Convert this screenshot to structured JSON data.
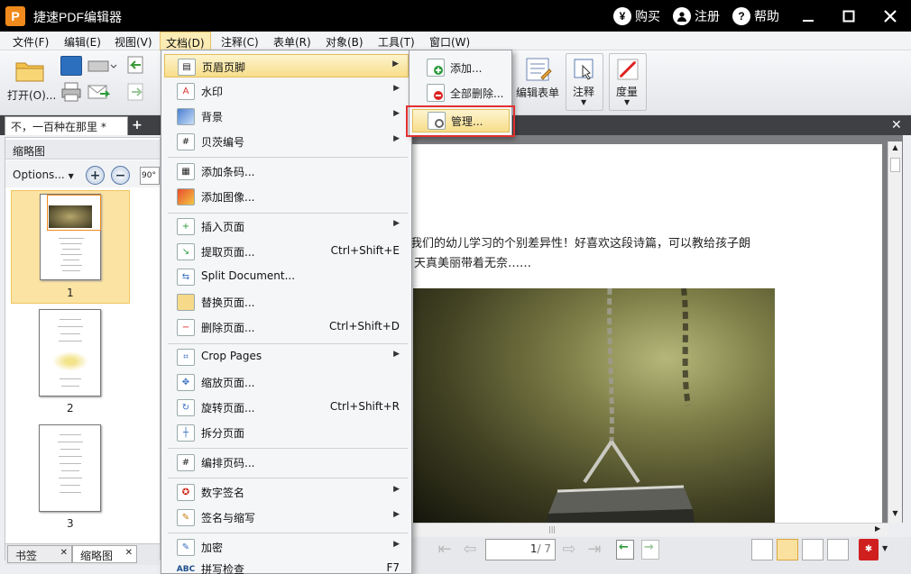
{
  "app": {
    "logo": "P",
    "title": "捷速PDF编辑器"
  },
  "titlebar": {
    "buy": "购买",
    "register": "注册",
    "help": "帮助",
    "buy_icon": "¥",
    "register_icon": "user-icon",
    "help_icon": "?"
  },
  "menubar": [
    "文件(F)",
    "编辑(E)",
    "视图(V)",
    "文档(D)",
    "注释(C)",
    "表单(R)",
    "对象(B)",
    "工具(T)",
    "窗口(W)"
  ],
  "toolbar": {
    "open_label": "打开(O)...",
    "edit_form_label": "编辑表单",
    "annotate_label": "注释",
    "measure_label": "度量"
  },
  "doc_tab": {
    "label": "不，一百种在那里 *"
  },
  "left_panel": {
    "title": "缩略图",
    "options_label": "Options...",
    "rotate_label": "90°",
    "thumbnails": [
      "1",
      "2",
      "3"
    ],
    "bottom_tabs": [
      {
        "label": "书签"
      },
      {
        "label": "缩略图"
      }
    ]
  },
  "document": {
    "line1": "我们的幼儿学习的个别差异性！好喜欢这段诗篇，可以教给孩子朗",
    "line2": "天真美丽带着无奈……"
  },
  "statusbar": {
    "page_value": "1",
    "page_total": "/ 7"
  },
  "doc_menu": [
    {
      "label": "页眉页脚",
      "arrow": "▶",
      "selected": true
    },
    {
      "label": "水印",
      "arrow": "▶"
    },
    {
      "label": "背景",
      "arrow": "▶"
    },
    {
      "label": "贝茨编号",
      "arrow": "▶"
    },
    {
      "label": "添加条码..."
    },
    {
      "label": "添加图像..."
    },
    {
      "label": "插入页面",
      "arrow": "▶"
    },
    {
      "label": "提取页面...",
      "shortcut": "Ctrl+Shift+E"
    },
    {
      "label": "Split Document..."
    },
    {
      "label": "替换页面..."
    },
    {
      "label": "删除页面...",
      "shortcut": "Ctrl+Shift+D"
    },
    {
      "label": "Crop Pages",
      "arrow": "▶"
    },
    {
      "label": "缩放页面..."
    },
    {
      "label": "旋转页面...",
      "shortcut": "Ctrl+Shift+R"
    },
    {
      "label": "拆分页面"
    },
    {
      "label": "编排页码..."
    },
    {
      "label": "数字签名",
      "arrow": "▶"
    },
    {
      "label": "签名与缩写",
      "arrow": "▶"
    },
    {
      "label": "加密",
      "arrow": "▶"
    },
    {
      "label": "拼写检查",
      "shortcut": "F7"
    }
  ],
  "sub_menu": [
    {
      "label": "添加..."
    },
    {
      "label": "全部删除..."
    },
    {
      "label": "管理..."
    }
  ]
}
